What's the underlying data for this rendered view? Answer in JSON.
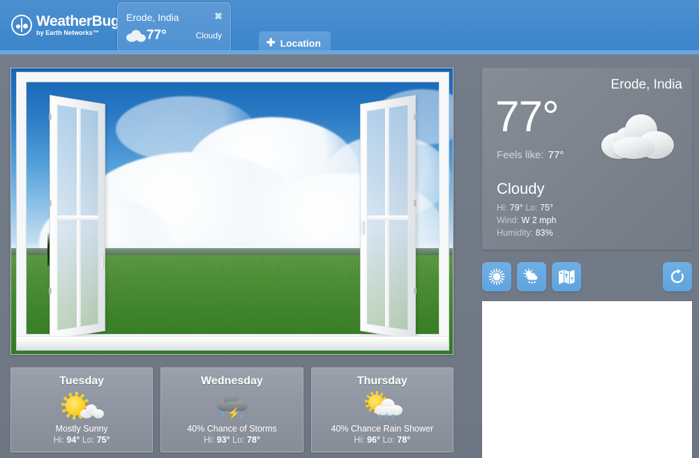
{
  "header": {
    "brand": {
      "title": "WeatherBug",
      "trademark": "®",
      "subtitle": "by Earth Networks™",
      "logo_icon": "weatherbug-ladybug-icon"
    },
    "location_tab": {
      "city": "Erode, India",
      "temperature": "77°",
      "condition": "Cloudy",
      "close_label": "✖",
      "icon": "cloudy-icon"
    },
    "add_tab": {
      "plus": "✚",
      "label": "Location"
    }
  },
  "photo": {
    "alt_name": "open-window-sky-field-photo"
  },
  "current": {
    "city": "Erode, India",
    "temperature": "77°",
    "feels_like_label": "Feels like:",
    "feels_like_value": "77°",
    "condition": "Cloudy",
    "hi_lo": "Hi: 79° Lo: 75°",
    "hi_label": "Hi:",
    "hi_value": "79°",
    "lo_label": "Lo:",
    "lo_value": "75°",
    "wind_label": "Wind:",
    "wind_value": "W 2 mph",
    "humidity_label": "Humidity:",
    "humidity_value": "83%",
    "icon": "cloudy-icon"
  },
  "actions": {
    "buttons": [
      {
        "name": "current-conditions-button",
        "icon": "sun-icon"
      },
      {
        "name": "forecast-button",
        "icon": "sun-cloud-rain-icon"
      },
      {
        "name": "map-button",
        "icon": "map-icon"
      },
      {
        "name": "refresh-button",
        "icon": "refresh-icon"
      }
    ]
  },
  "forecast": {
    "days": [
      {
        "day": "Tuesday",
        "condition": "Mostly Sunny",
        "hi_label": "Hi:",
        "hi": "94°",
        "lo_label": "Lo:",
        "lo": "75°",
        "icon": "mostly-sunny-icon"
      },
      {
        "day": "Wednesday",
        "condition": "40% Chance of Storms",
        "hi_label": "Hi:",
        "hi": "93°",
        "lo_label": "Lo:",
        "lo": "78°",
        "icon": "thunderstorm-icon"
      },
      {
        "day": "Thursday",
        "condition": "40% Chance Rain Shower",
        "hi_label": "Hi:",
        "hi": "96°",
        "lo_label": "Lo:",
        "lo": "78°",
        "icon": "sun-cloud-rain-icon"
      }
    ]
  },
  "ad_panel": {
    "content": ""
  },
  "colors": {
    "header_blue": "#4189cd",
    "header_strip": "#6aa9e0",
    "tab_blue": "#5d9ad6",
    "button_blue": "#5fa3de",
    "body_gray": "#737b89",
    "panel_gray": "#7d848e",
    "card_gray": "#8f96a1",
    "text_white": "#ffffff",
    "text_muted": "#c9ccd1"
  }
}
